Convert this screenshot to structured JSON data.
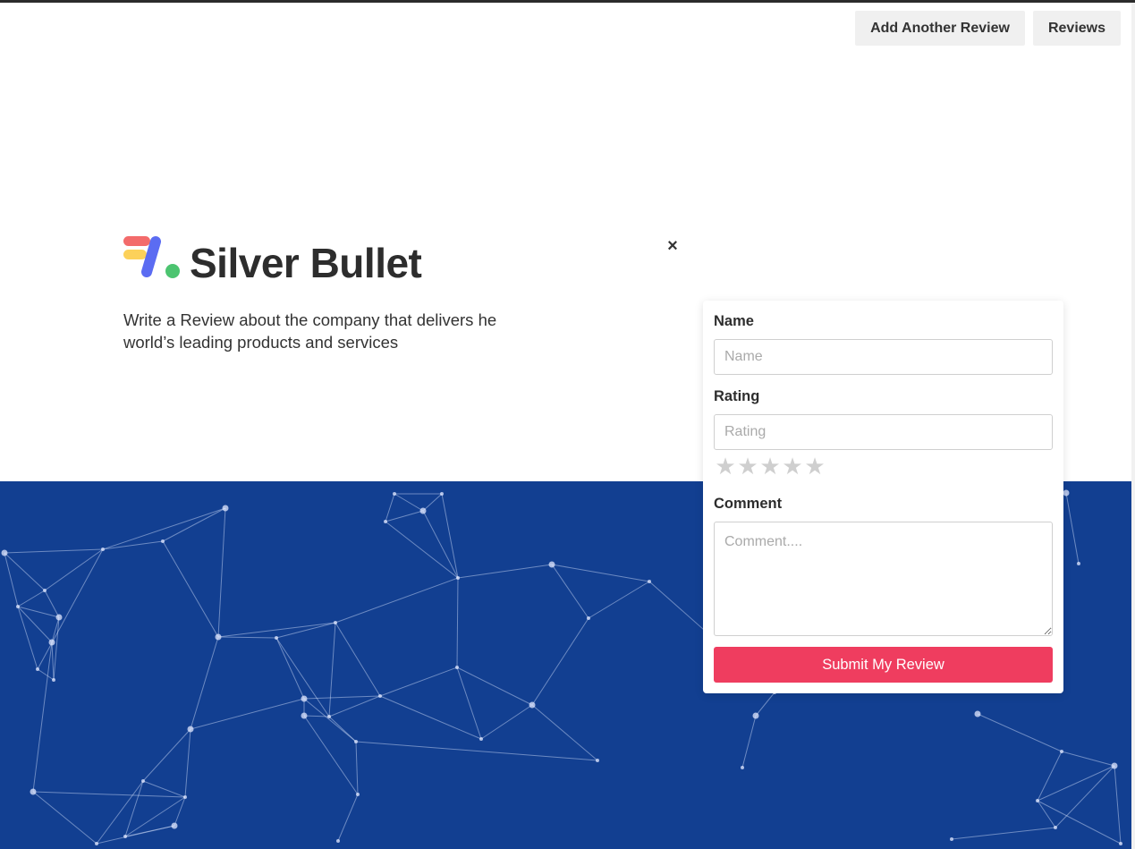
{
  "nav": {
    "add_label": "Add Another Review",
    "reviews_label": "Reviews"
  },
  "brand": {
    "name": "Silver Bullet",
    "tagline": "Write a Review about the company that delivers he world’s leading products and services"
  },
  "dialog": {
    "close_label": "×"
  },
  "form": {
    "name_label": "Name",
    "name_placeholder": "Name",
    "rating_label": "Rating",
    "rating_placeholder": "Rating",
    "stars": [
      "★",
      "★",
      "★",
      "★",
      "★"
    ],
    "comment_label": "Comment",
    "comment_placeholder": "Comment....",
    "submit_label": "Submit My Review"
  },
  "colors": {
    "hero_bg": "#123f91",
    "accent": "#ef3d5f",
    "logo_red": "#f36b6b",
    "logo_yellow": "#fcd15a",
    "logo_blue": "#5b6cf2",
    "logo_green": "#4cc470"
  }
}
